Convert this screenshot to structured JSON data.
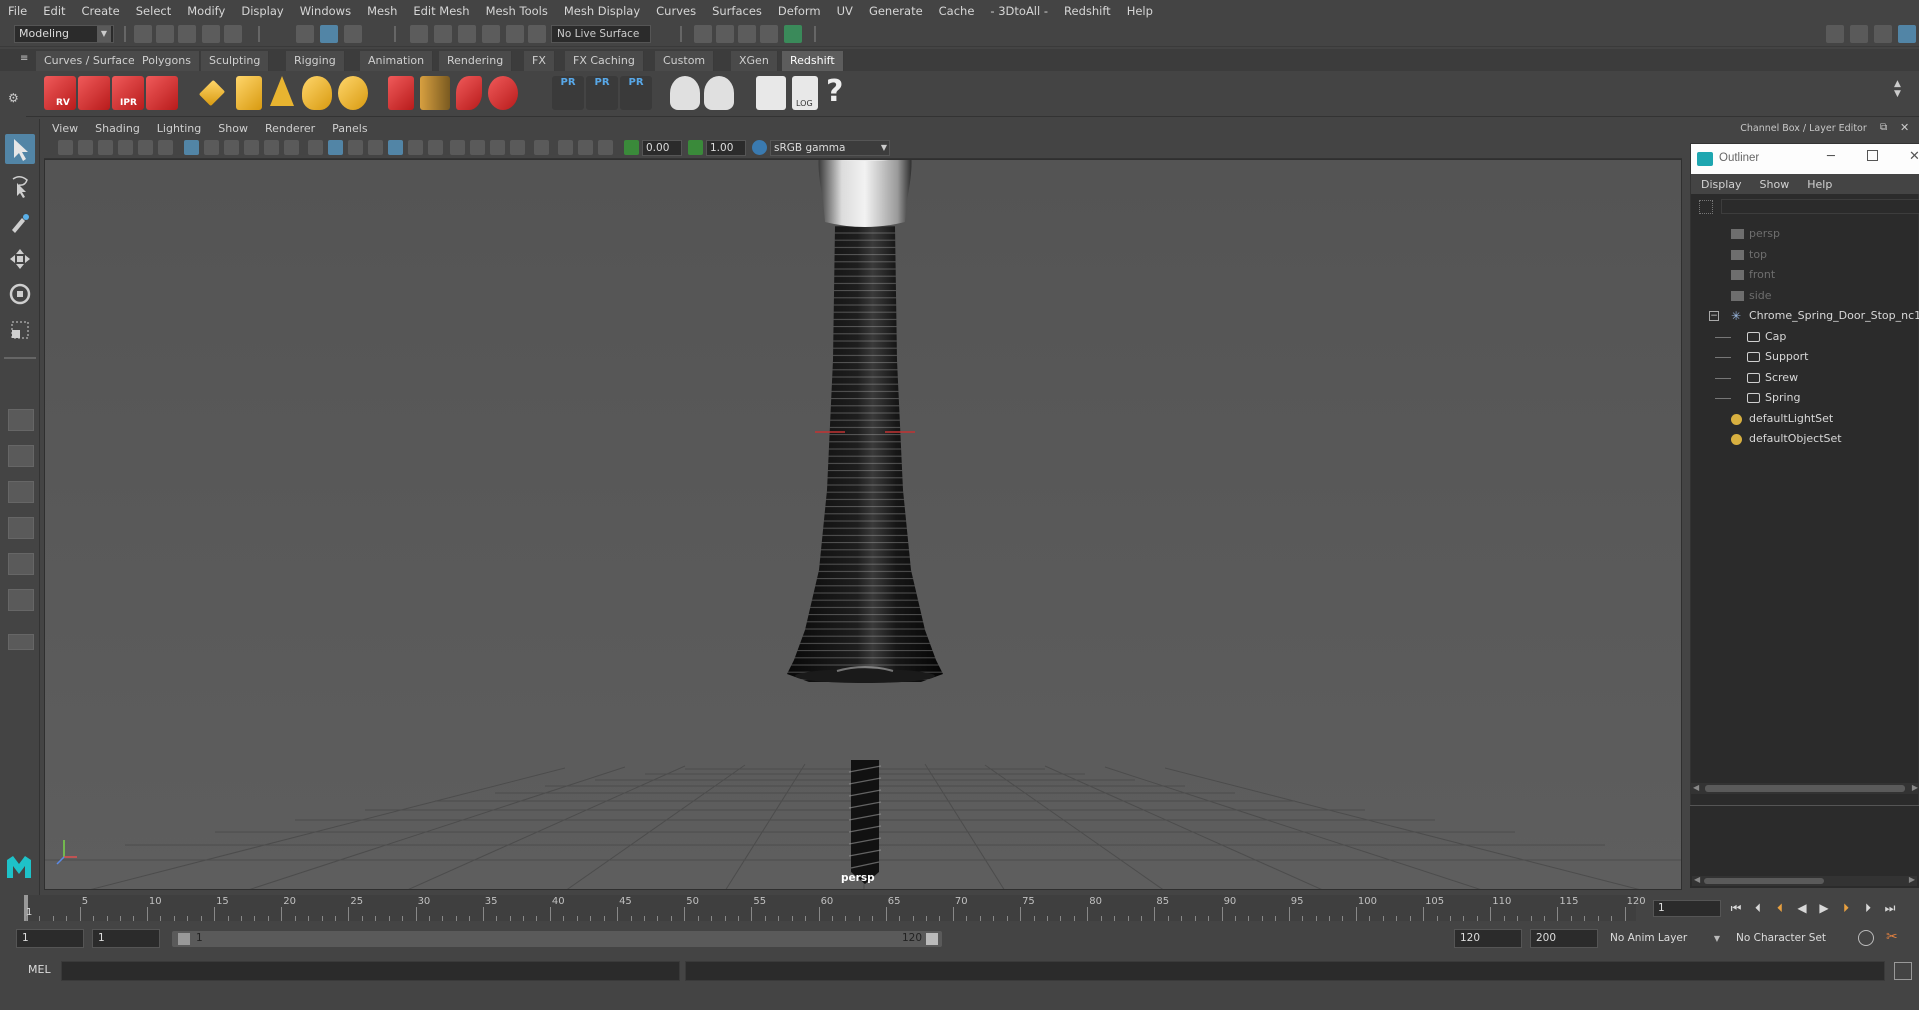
{
  "menu": [
    "File",
    "Edit",
    "Create",
    "Select",
    "Modify",
    "Display",
    "Windows",
    "Mesh",
    "Edit Mesh",
    "Mesh Tools",
    "Mesh Display",
    "Curves",
    "Surfaces",
    "Deform",
    "UV",
    "Generate",
    "Cache",
    "- 3DtoAll -",
    "Redshift",
    "Help"
  ],
  "status_line": {
    "workspace": "Modeling",
    "live_surface": "No Live Surface"
  },
  "shelf_tabs": [
    "Curves / Surfaces",
    "Polygons",
    "Sculpting",
    "Rigging",
    "Animation",
    "Rendering",
    "FX",
    "FX Caching",
    "Custom",
    "XGen",
    "Redshift"
  ],
  "active_shelf_tab": "Redshift",
  "shelf": {
    "rv_label": "RV",
    "ipr_label": "IPR",
    "pr_labels": [
      "PR",
      "PR",
      "PR"
    ],
    "log_label": "LOG",
    "help_label": "?"
  },
  "panel_menu": [
    "View",
    "Shading",
    "Lighting",
    "Show",
    "Renderer",
    "Panels"
  ],
  "panel_bar": {
    "exposure": "0.00",
    "gamma": "1.00",
    "color_space": "sRGB gamma"
  },
  "viewport": {
    "camera_label": "persp",
    "background": "#5a5a5a"
  },
  "channel_box_title": "Channel Box / Layer Editor",
  "outliner": {
    "title": "Outliner",
    "menu": [
      "Display",
      "Show",
      "Help"
    ],
    "items": [
      {
        "label": "persp",
        "icon": "camera-icon",
        "dim": true
      },
      {
        "label": "top",
        "icon": "camera-icon",
        "dim": true
      },
      {
        "label": "front",
        "icon": "camera-icon",
        "dim": true
      },
      {
        "label": "side",
        "icon": "camera-icon",
        "dim": true
      },
      {
        "label": "Chrome_Spring_Door_Stop_nc1",
        "icon": "group-icon",
        "dim": false
      },
      {
        "label": "Cap",
        "icon": "mesh-icon",
        "dim": false
      },
      {
        "label": "Support",
        "icon": "mesh-icon",
        "dim": false
      },
      {
        "label": "Screw",
        "icon": "mesh-icon",
        "dim": false
      },
      {
        "label": "Spring",
        "icon": "mesh-icon",
        "dim": false
      },
      {
        "label": "defaultLightSet",
        "icon": "set-icon",
        "dim": false
      },
      {
        "label": "defaultObjectSet",
        "icon": "set-icon",
        "dim": false
      }
    ]
  },
  "timeline": {
    "ticks": [
      "5",
      "10",
      "15",
      "20",
      "25",
      "30",
      "35",
      "40",
      "45",
      "50",
      "55",
      "60",
      "65",
      "70",
      "75",
      "80",
      "85",
      "90",
      "95",
      "100",
      "105",
      "110",
      "115",
      "120"
    ],
    "start_marker": "1",
    "current_frame": "1"
  },
  "range": {
    "start": "1",
    "playback_start": "1",
    "bar_start": "1",
    "bar_end": "120",
    "playback_end": "120",
    "end": "200",
    "anim_layer": "No Anim Layer",
    "character_set": "No Character Set"
  },
  "command_line": {
    "lang": "MEL"
  },
  "colors": {
    "accent": "#5285a6",
    "redshift_red": "#d62a2a",
    "panel": "#444444",
    "field": "#2b2b2b"
  }
}
